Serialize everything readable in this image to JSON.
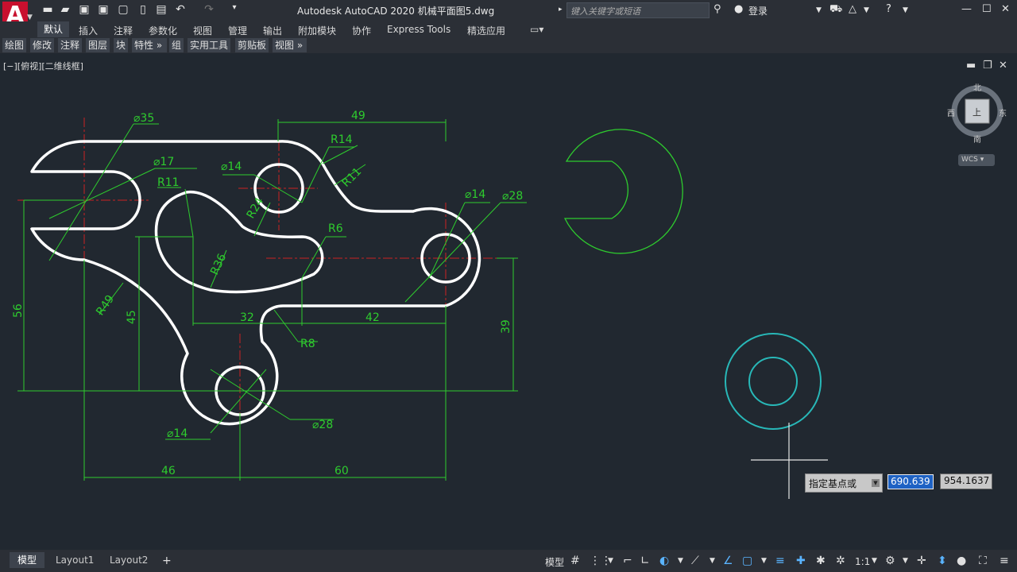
{
  "titlebar": {
    "app_title": "Autodesk AutoCAD 2020    机械平面图5.dwg",
    "search_placeholder": "键入关键字或短语",
    "login": "登录"
  },
  "ribbon": {
    "tabs": [
      "默认",
      "插入",
      "注释",
      "参数化",
      "视图",
      "管理",
      "输出",
      "附加模块",
      "协作",
      "Express Tools",
      "精选应用"
    ]
  },
  "panels": [
    "绘图",
    "修改",
    "注释",
    "图层",
    "块",
    "特性",
    "组",
    "实用工具",
    "剪贴板",
    "视图"
  ],
  "viewport": {
    "label": "[−][俯视][二维线框]"
  },
  "viewcube": {
    "north": "北",
    "south": "南",
    "east": "东",
    "west": "西",
    "face": "上",
    "wcs": "WCS"
  },
  "dimensions": {
    "d35": "⌀35",
    "d17": "⌀17",
    "d14a": "⌀14",
    "r11a": "R11",
    "r14": "R14",
    "r11b": "R11",
    "r24": "R24",
    "r36": "R36",
    "r6": "R6",
    "d14b": "⌀14",
    "d28a": "⌀28",
    "r49": "R49",
    "v45": "45",
    "v56": "56",
    "h32": "32",
    "h42": "42",
    "r8": "R8",
    "v39": "39",
    "h49": "49",
    "d14c": "⌀14",
    "d28b": "⌀28",
    "h46": "46",
    "h60": "60"
  },
  "dynamic_input": {
    "prompt": "指定基点或",
    "x_value": "690.639",
    "y_value": "954.1637"
  },
  "layout_tabs": [
    "模型",
    "Layout1",
    "Layout2"
  ],
  "statusbar": {
    "model": "模型",
    "scale": "1:1"
  },
  "colors": {
    "dim": "#2ecc2e",
    "center": "#cc2222",
    "outline": "#ffffff",
    "cyan": "#28b8b8",
    "background": "#212830"
  }
}
